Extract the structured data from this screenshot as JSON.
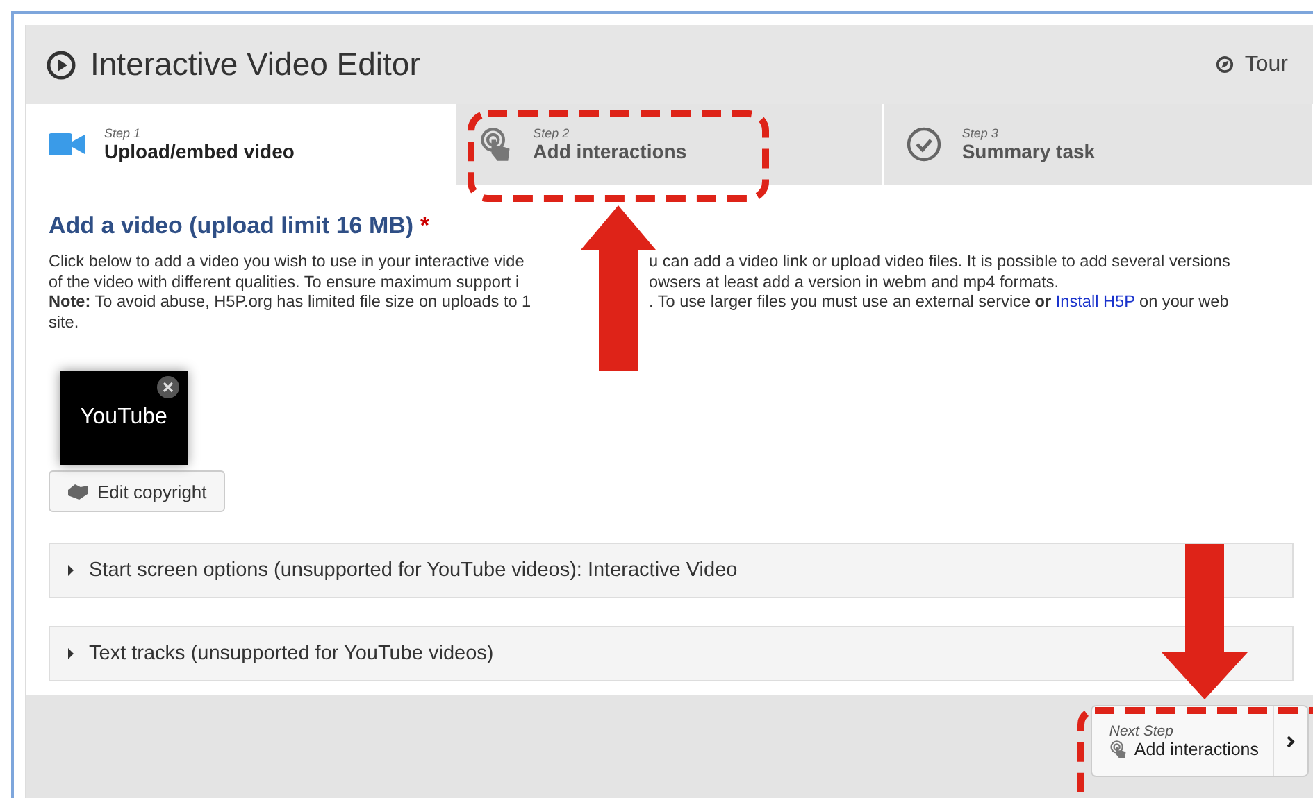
{
  "header": {
    "title": "Interactive Video Editor",
    "tour": "Tour"
  },
  "steps": [
    {
      "step": "Step 1",
      "label": "Upload/embed video",
      "kind": "video",
      "selected": true
    },
    {
      "step": "Step 2",
      "label": "Add interactions",
      "kind": "interactions",
      "selected": false
    },
    {
      "step": "Step 3",
      "label": "Summary task",
      "kind": "summary",
      "selected": false
    }
  ],
  "section": {
    "title": "Add a video (upload limit 16 MB)",
    "required": "*",
    "description_lines": [
      {
        "left": "Click below to add a video you wish to use in your interactive vide",
        "right": "u can add a video link or upload video files. It is possible to add several versions"
      },
      {
        "left": "of the video with different qualities. To ensure maximum support i",
        "right": "owsers at least add a version in webm and mp4 formats."
      }
    ],
    "note_left": "**Note:** To avoid abuse, H5P.org has limited file size on uploads to 1",
    "note_right": ". To use larger files you must use an external service **or**",
    "note_link": "Install H5P",
    "note_end": "on your web",
    "note_last": "site."
  },
  "video": {
    "thumbnail": "YouTube",
    "copyright_button": "Edit copyright"
  },
  "collapsibles": [
    {
      "label": "Start screen options (unsupported for YouTube videos): Interactive Video",
      "expanded": false
    },
    {
      "label": "Text tracks (unsupported for YouTube videos)",
      "expanded": false
    }
  ],
  "next_step": {
    "caption": "Next Step",
    "label": "Add interactions"
  }
}
